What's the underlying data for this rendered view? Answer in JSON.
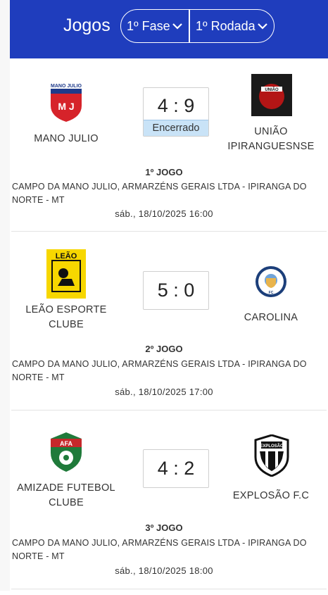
{
  "header": {
    "title": "Jogos",
    "fase_label": "1º Fase",
    "rodada_label": "1º Rodada"
  },
  "games": [
    {
      "home": "MANO JULIO",
      "away": "UNIÃO IPIRANGUESNSE",
      "score": "4 : 9",
      "status": "Encerrado",
      "number": "1º JOGO",
      "venue": "CAMPO DA MANO JULIO, ARMARZÉNS GERAIS LTDA - IPIRANGA DO NORTE - MT",
      "datetime": "sáb., 18/10/2025 16:00",
      "home_logo_text": [
        "MANO JULIO",
        "M J"
      ],
      "away_logo_text": [
        "UNIÃO"
      ]
    },
    {
      "home": "LEÃO ESPORTE CLUBE",
      "away": "CAROLINA",
      "score": "5 : 0",
      "number": "2º JOGO",
      "venue": "CAMPO DA MANO JULIO, ARMARZÉNS GERAIS LTDA - IPIRANGA DO NORTE - MT",
      "datetime": "sáb., 18/10/2025 17:00",
      "home_logo_text": [
        "LEÃO"
      ],
      "away_logo_text": [
        "FC"
      ]
    },
    {
      "home": "AMIZADE FUTEBOL CLUBE",
      "away": "EXPLOSÃO F.C",
      "score": "4 : 2",
      "number": "3º JOGO",
      "venue": "CAMPO DA MANO JULIO, ARMARZÉNS GERAIS LTDA - IPIRANGA DO NORTE - MT",
      "datetime": "sáb., 18/10/2025 18:00",
      "home_logo_text": [
        "AFA"
      ],
      "away_logo_text": [
        "EXPLOSÃO"
      ]
    }
  ]
}
